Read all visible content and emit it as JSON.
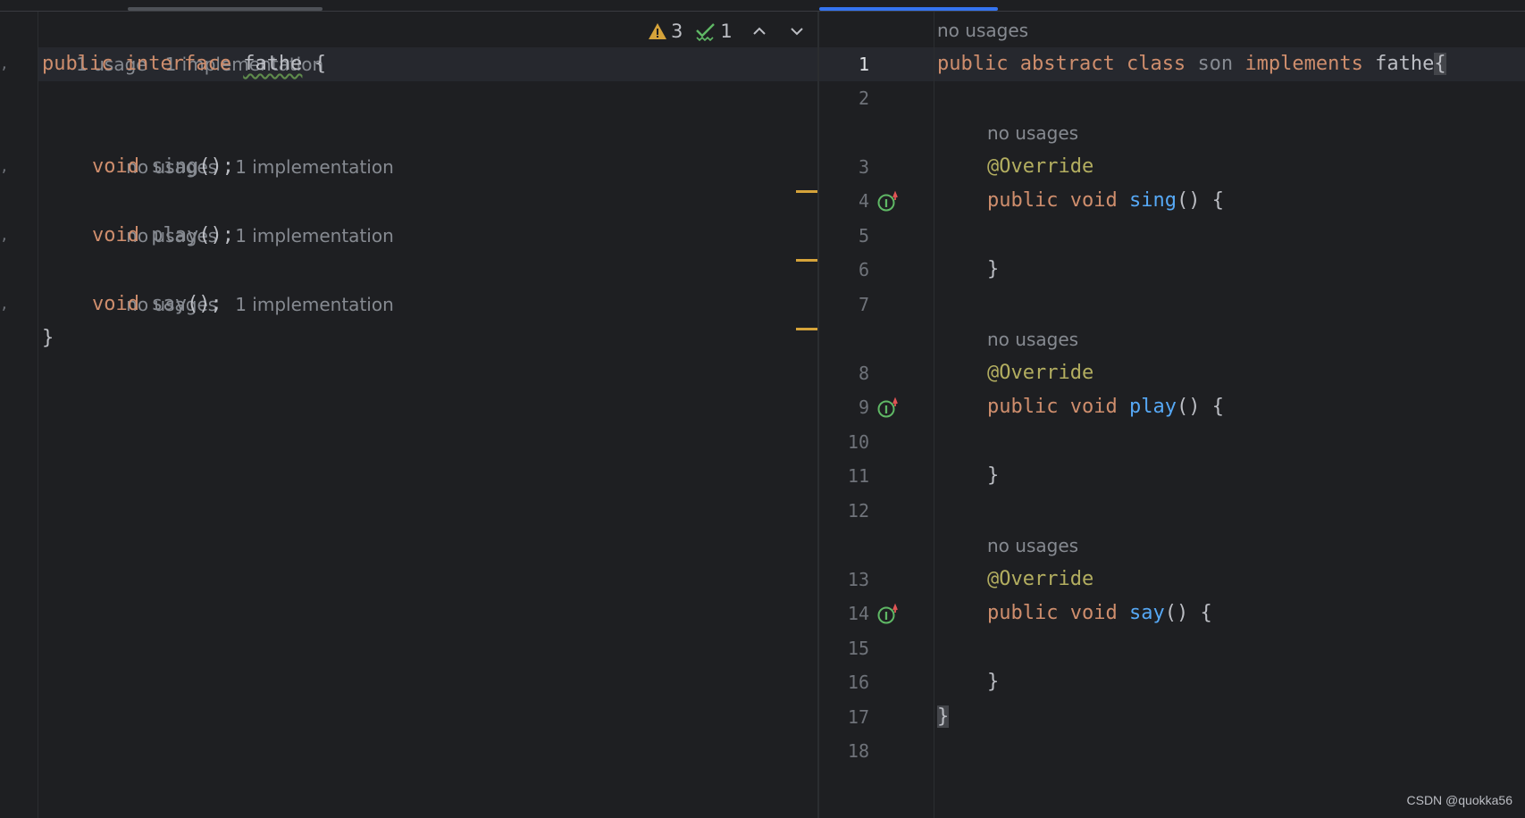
{
  "left_editor": {
    "header_hints": [
      "1 usage",
      "1 implementation"
    ],
    "inspection": {
      "warnings": "3",
      "checks": "1",
      "warning_icon": "warning-triangle-icon",
      "check_icon": "double-check-icon",
      "prev_icon": "chevron-up-icon",
      "next_icon": "chevron-down-icon"
    },
    "code": {
      "l1_kw1": "public",
      "l1_kw2": "interface",
      "l1_name": "fathe",
      "l1_brace": "{",
      "m1_hints": [
        "no usages",
        "1 implementation"
      ],
      "m1_type": "void",
      "m1_name": "sing",
      "m1_rest": "();",
      "m2_hints": [
        "no usages",
        "1 implementation"
      ],
      "m2_type": "void",
      "m2_name": "play",
      "m2_rest": "();",
      "m3_hints": [
        "no usages",
        "1 implementation"
      ],
      "m3_type": "void",
      "m3_name": "say",
      "m3_rest": "();",
      "close": "}"
    }
  },
  "right_editor": {
    "header_hint": "no usages",
    "line_numbers": [
      "1",
      "2",
      "3",
      "4",
      "5",
      "6",
      "7",
      "8",
      "9",
      "10",
      "11",
      "12",
      "13",
      "14",
      "15",
      "16",
      "17",
      "18"
    ],
    "code": {
      "l1_kw1": "public",
      "l1_kw2": "abstract",
      "l1_kw3": "class",
      "l1_name": "son",
      "l1_kw4": "implements",
      "l1_iface": "fathe",
      "l1_brace": "{",
      "hint_no_usages": "no usages",
      "annotation": "@Override",
      "pub": "public",
      "void": "void",
      "m1_name": "sing",
      "m2_name": "play",
      "m3_name": "say",
      "sig_rest": "() {",
      "close_brace": "}",
      "class_close": "}"
    },
    "gutter_icon": "implements-method-icon"
  },
  "watermark": "CSDN @quokka56",
  "colors": {
    "background": "#1e1f22",
    "keyword": "#cf8e6d",
    "function": "#56a8f5",
    "annotation": "#b3ae60",
    "hint": "#868a91",
    "warning": "#d5a33a",
    "accent": "#3574f0"
  }
}
